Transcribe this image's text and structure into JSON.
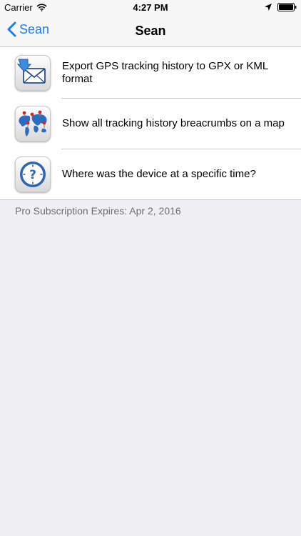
{
  "status_bar": {
    "carrier": "Carrier",
    "time": "4:27 PM"
  },
  "nav": {
    "back_label": "Sean",
    "title": "Sean"
  },
  "rows": [
    {
      "label": "Export GPS tracking history to GPX or KML format",
      "icon": "envelope-export-icon"
    },
    {
      "label": "Show all tracking history breacrumbs on a map",
      "icon": "world-map-icon"
    },
    {
      "label": "Where was the device at a specific time?",
      "icon": "clock-question-icon"
    }
  ],
  "footer": {
    "subscription_text": "Pro Subscription Expires: Apr 2, 2016"
  },
  "colors": {
    "accent": "#1a7cf9",
    "background": "#efeff4",
    "separator": "#c8c7cc",
    "footer_text": "#6d6d72"
  }
}
